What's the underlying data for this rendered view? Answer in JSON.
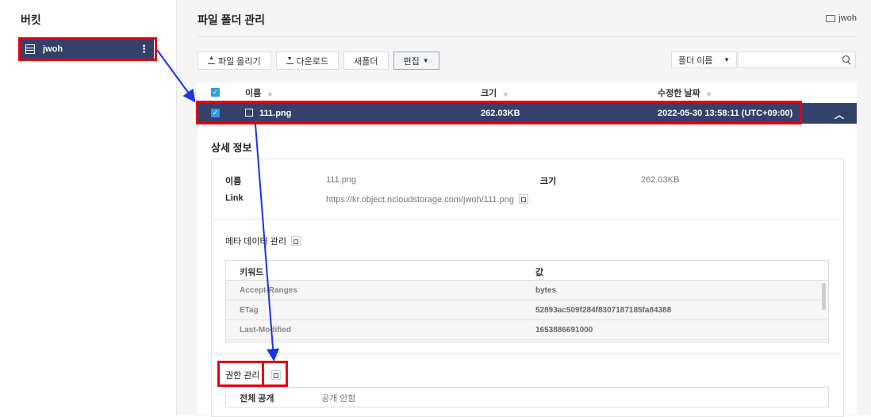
{
  "sidebar": {
    "title": "버킷",
    "bucket": {
      "name": "jwoh",
      "more": "⋮"
    }
  },
  "header": {
    "title": "파일 폴더 관리",
    "breadcrumb": "jwoh"
  },
  "toolbar": {
    "upload": "파일 올리기",
    "download": "다운로드",
    "new_folder": "새폴더",
    "edit": "편집"
  },
  "search": {
    "select": "폴더 이름",
    "placeholder": ""
  },
  "table": {
    "headers": {
      "name": "이름",
      "size": "크기",
      "modified": "수정한 날짜"
    },
    "selected_row": {
      "name": "111.png",
      "size": "262.03KB",
      "modified": "2022-05-30 13:58:11 (UTC+09:00)"
    }
  },
  "detail": {
    "title": "상세 정보",
    "name_key": "이름",
    "name_val": "111.png",
    "size_key": "크기",
    "size_val": "262.03KB",
    "link_key": "Link",
    "link_val": "https://kr.object.ncloudstorage.com/jwoh/111.png",
    "meta_title": "메타 데이터 관리",
    "meta_headers": {
      "key": "키워드",
      "value": "값"
    },
    "meta_rows": [
      {
        "key": "Accept-Ranges",
        "value": "bytes"
      },
      {
        "key": "ETag",
        "value": "52893ac509f284f8307187185fa84388"
      },
      {
        "key": "Last-Modified",
        "value": "1653886691000"
      }
    ],
    "perm_title": "권한 관리",
    "perm_key": "전체 공개",
    "perm_val": "공개 안함"
  },
  "colors": {
    "selected": "#34416a",
    "checkbox": "#2f9be0",
    "annotation_box": "#e40010",
    "annotation_arrow": "#1a33e8"
  }
}
